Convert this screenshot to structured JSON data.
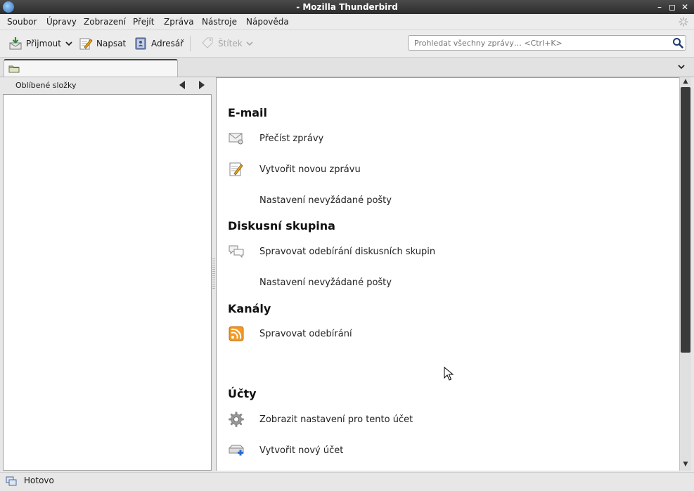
{
  "window": {
    "title": "- Mozilla Thunderbird"
  },
  "menubar": {
    "items": [
      "Soubor",
      "Úpravy",
      "Zobrazení",
      "Přejít",
      "Zpráva",
      "Nástroje",
      "Nápověda"
    ]
  },
  "toolbar": {
    "get_mail": "Přijmout",
    "write": "Napsat",
    "address_book": "Adresář",
    "tag": "Štítek"
  },
  "search": {
    "placeholder": "Prohledat všechny zprávy… <Ctrl+K>"
  },
  "folder_pane": {
    "header": "Oblíbené složky"
  },
  "account_central": {
    "email": {
      "title": "E-mail",
      "read": "Přečíst zprávy",
      "compose": "Vytvořit novou zprávu",
      "junk": "Nastavení nevyžádané pošty"
    },
    "news": {
      "title": "Diskusní skupina",
      "subscribe": "Spravovat odebírání diskusních skupin",
      "junk": "Nastavení nevyžádané pošty"
    },
    "feeds": {
      "title": "Kanály",
      "subscribe": "Spravovat odebírání"
    },
    "accounts": {
      "title": "Účty",
      "settings": "Zobrazit nastavení pro tento účet",
      "new_account": "Vytvořit nový účet"
    }
  },
  "statusbar": {
    "text": "Hotovo"
  }
}
